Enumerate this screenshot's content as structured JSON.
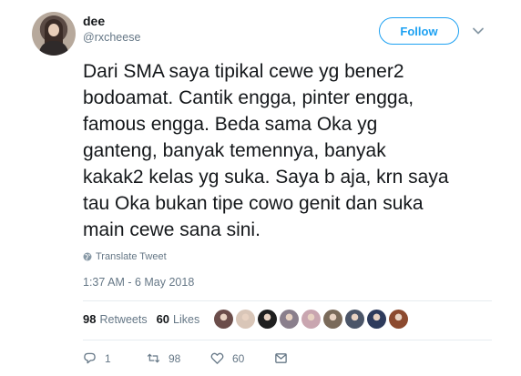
{
  "user": {
    "name": "dee",
    "handle": "@rxcheese"
  },
  "follow_label": "Follow",
  "tweet": {
    "lines": [
      "Dari SMA saya tipikal cewe yg bener2",
      "bodoamat. Cantik engga, pinter engga,",
      "famous engga. Beda sama Oka yg",
      "ganteng, banyak temennya, banyak",
      "kakak2 kelas yg suka. Saya b aja, krn saya",
      "tau Oka bukan tipe cowo genit dan suka",
      "main cewe sana sini."
    ]
  },
  "translate_label": "Translate Tweet",
  "timestamp": "1:37 AM - 6 May 2018",
  "stats": {
    "retweets_count": "98",
    "retweets_label": "Retweets",
    "likes_count": "60",
    "likes_label": "Likes"
  },
  "likers": [
    {
      "color": "#6b4d4a"
    },
    {
      "color": "#d9c6b8"
    },
    {
      "color": "#1f1f1f"
    },
    {
      "color": "#8a7f8c"
    },
    {
      "color": "#c9a6b0"
    },
    {
      "color": "#7a6a5a"
    },
    {
      "color": "#4b5568"
    },
    {
      "color": "#2e3b5c"
    },
    {
      "color": "#8c4a2f"
    }
  ],
  "actions": {
    "reply_count": "1",
    "retweet_count": "98",
    "like_count": "60"
  },
  "colors": {
    "accent": "#1da1f2",
    "text": "#14171a",
    "secondary": "#657786",
    "divider": "#e6ecf0"
  },
  "icons": [
    "caret-down-icon",
    "globe-icon",
    "reply-icon",
    "retweet-icon",
    "heart-icon",
    "message-icon"
  ]
}
